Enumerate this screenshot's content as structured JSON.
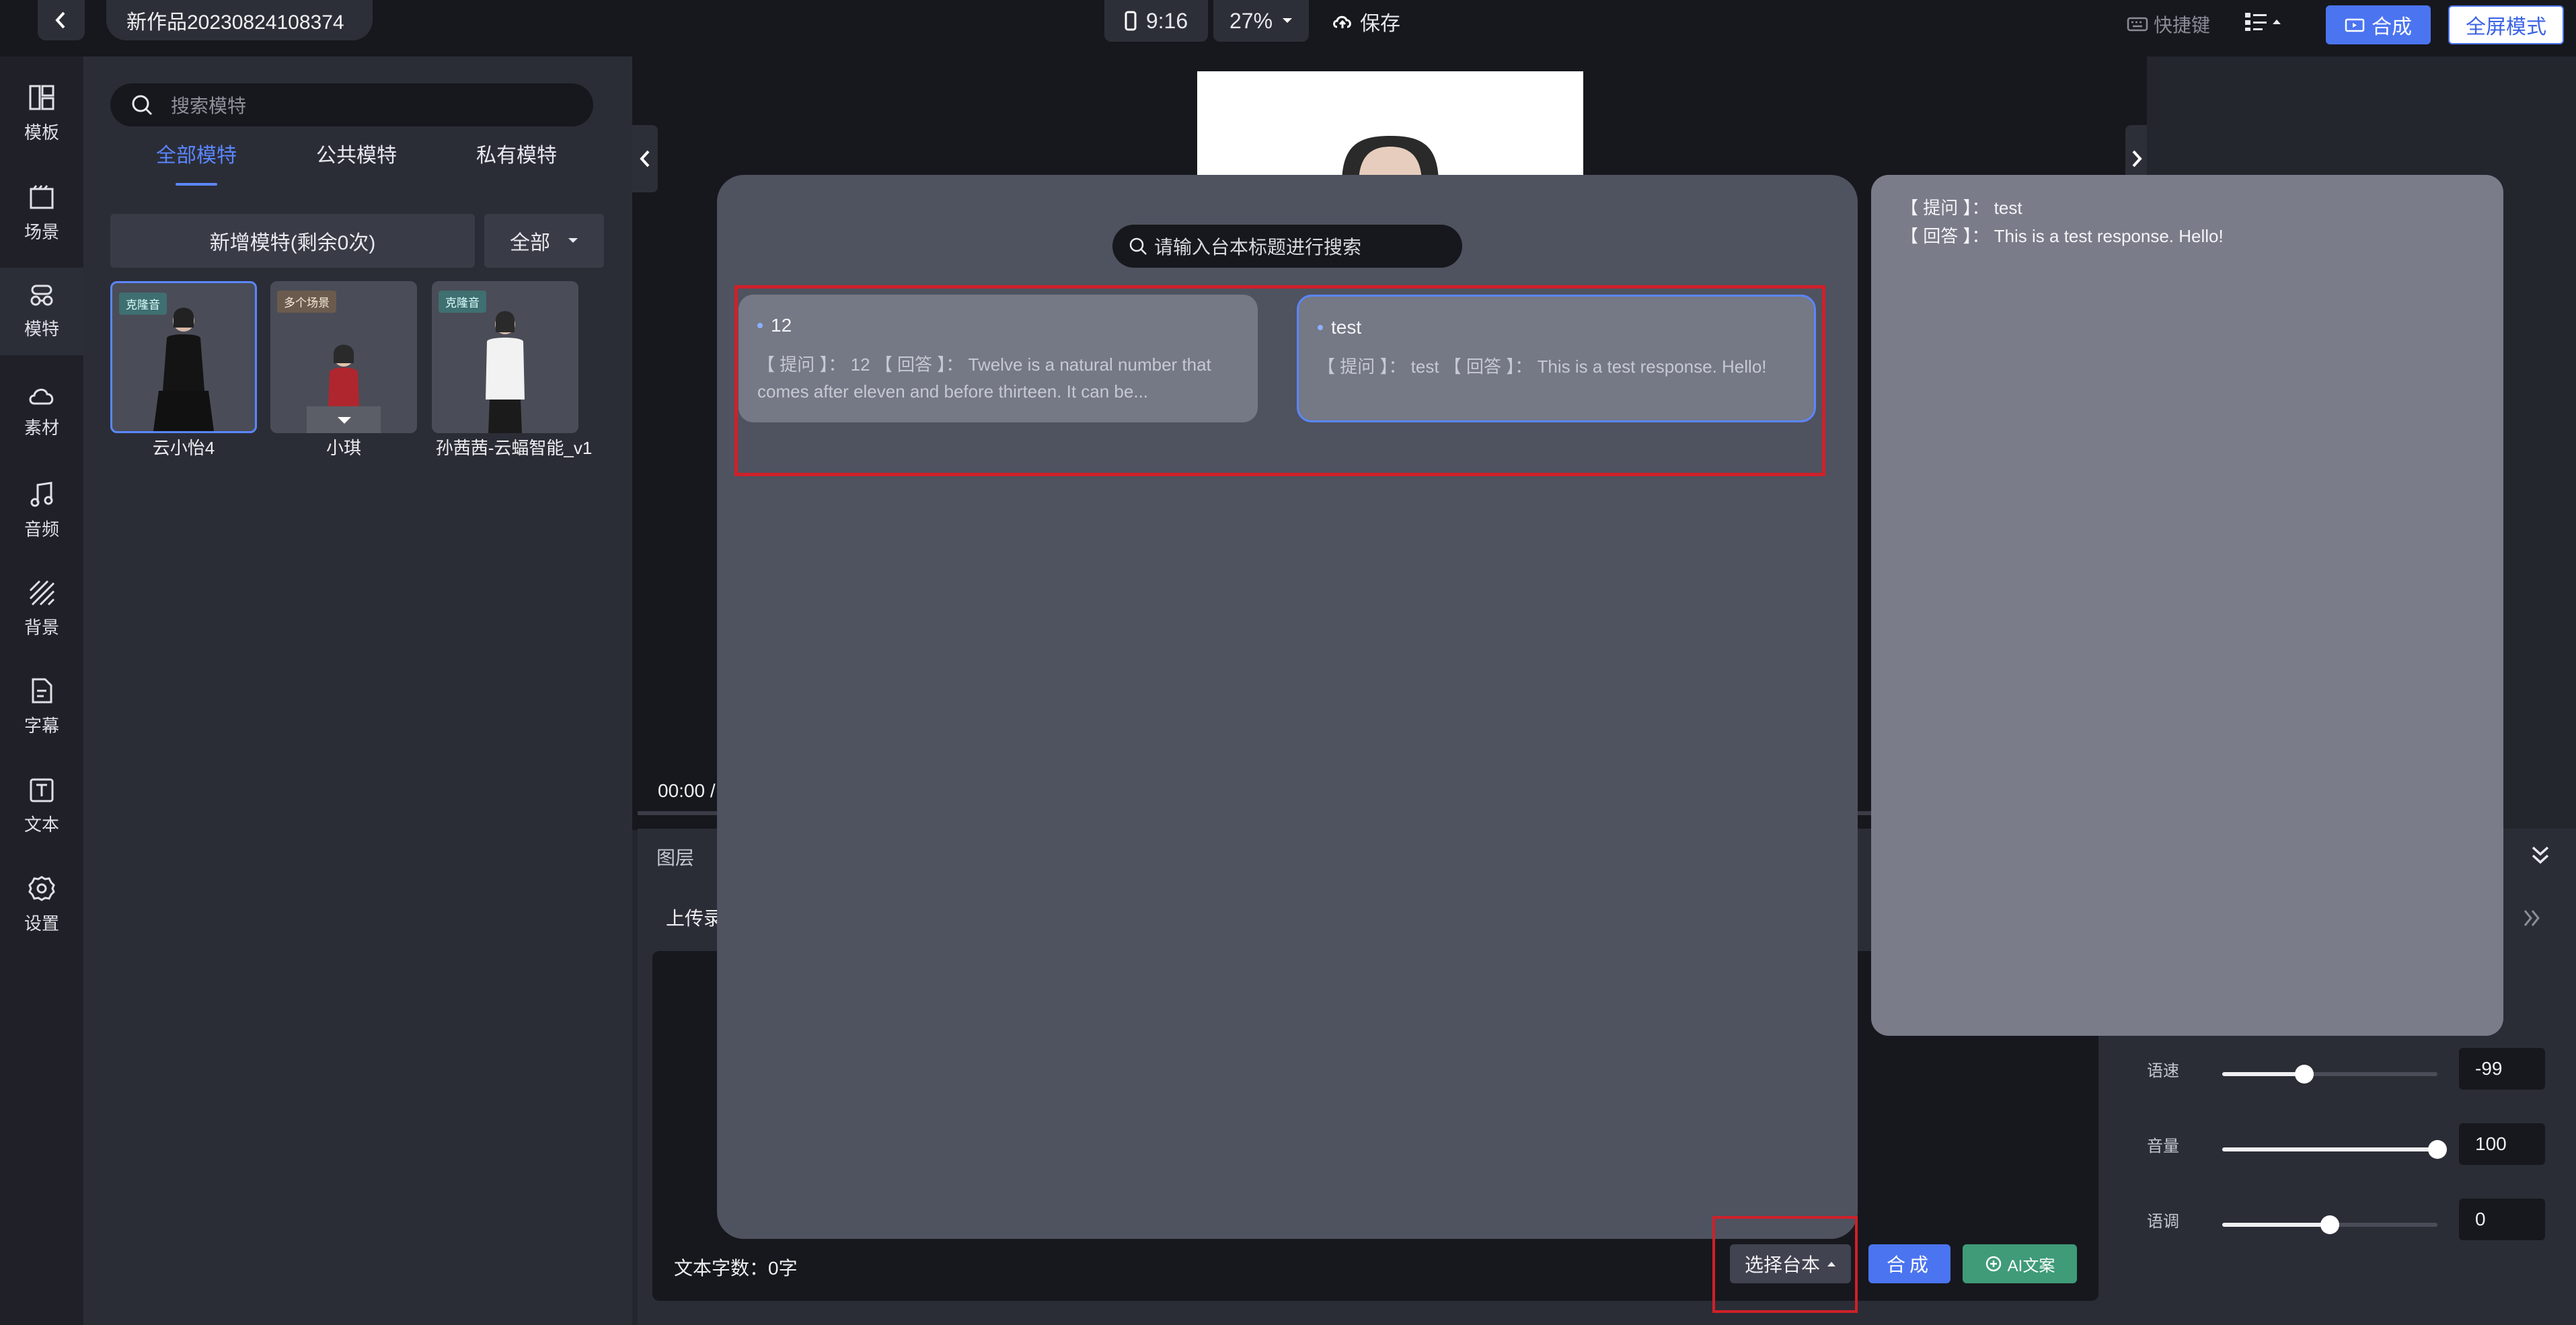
{
  "header": {
    "project_title": "新作品20230824108374",
    "ratio": "9:16",
    "zoom": "27%",
    "save_label": "保存",
    "shortcut_label": "快捷键",
    "compose_label": "合成",
    "fullscreen_label": "全屏模式"
  },
  "rail": {
    "items": [
      {
        "label": "模板",
        "icon": "template-icon"
      },
      {
        "label": "场景",
        "icon": "scene-icon"
      },
      {
        "label": "模特",
        "icon": "model-icon"
      },
      {
        "label": "素材",
        "icon": "cloud-icon"
      },
      {
        "label": "音频",
        "icon": "music-icon"
      },
      {
        "label": "背景",
        "icon": "background-icon"
      },
      {
        "label": "字幕",
        "icon": "subtitle-icon"
      },
      {
        "label": "文本",
        "icon": "text-icon"
      },
      {
        "label": "设置",
        "icon": "settings-icon"
      }
    ]
  },
  "models": {
    "search_placeholder": "搜索模特",
    "tabs": [
      "全部模特",
      "公共模特",
      "私有模特"
    ],
    "add_button": "新增模特(剩余0次)",
    "filter": "全部",
    "cards": [
      {
        "name": "云小怡4",
        "badge": "克隆音"
      },
      {
        "name": "小琪",
        "badge": "多个场景"
      },
      {
        "name": "孙茜茜-云蝠智能_v1",
        "badge": "克隆音"
      }
    ]
  },
  "canvas": {
    "time": "00:00 /",
    "layers_label": "图层",
    "upload_label": "上传录",
    "char_count": "文本字数：0字",
    "choose_script": "选择台本",
    "compose": "合成",
    "ai_copy": "AI文案"
  },
  "voice": {
    "speed_label": "语速",
    "speed_value": "-99",
    "speed_fraction": 0.38,
    "volume_label": "音量",
    "volume_value": "100",
    "volume_fraction": 1.0,
    "pitch_label": "语调",
    "pitch_value": "0",
    "pitch_fraction": 0.5
  },
  "modal": {
    "search_placeholder": "请输入台本标题进行搜索",
    "scripts": [
      {
        "title": "12",
        "body": "【 提问 】： 12 【 回答 】： Twelve is a natural number that comes after eleven and before thirteen. It can be..."
      },
      {
        "title": "test",
        "body": "【 提问 】： test 【 回答 】： This is a test response. Hello!"
      }
    ],
    "preview_lines": [
      "【 提问 】： test",
      "【 回答 】： This is a test response. Hello!"
    ]
  },
  "colors": {
    "accent": "#4b74f0",
    "highlight_red": "#d0202a",
    "ai_green": "#3f9b78"
  }
}
